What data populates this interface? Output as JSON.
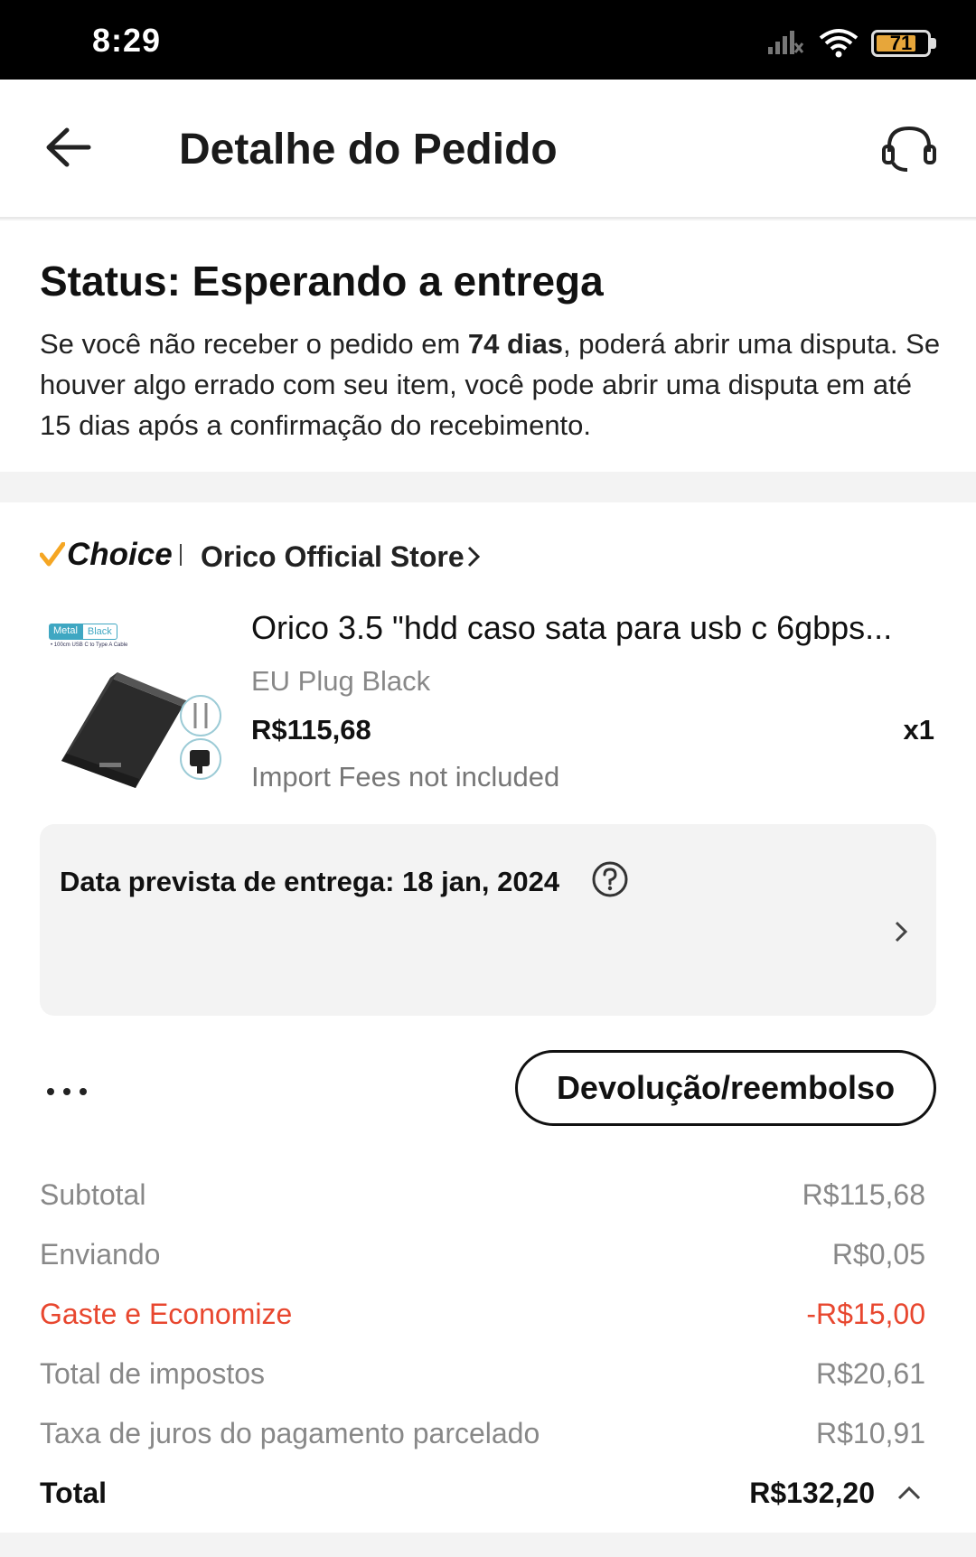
{
  "status_bar": {
    "time": "8:29",
    "battery_level": "71",
    "icons": [
      "signal-icon",
      "wifi-icon",
      "battery-icon"
    ]
  },
  "header": {
    "title": "Detalhe do Pedido",
    "back_icon": "arrow-left-icon",
    "support_icon": "headset-icon"
  },
  "status": {
    "title": "Status: Esperando a entrega",
    "desc_prefix": "Se você não receber o pedido em ",
    "desc_days": "74 dias",
    "desc_suffix": ", poderá abrir uma disputa. Se houver algo errado com seu item, você pode abrir uma disputa em até 15 dias após a confirmação do recebimento."
  },
  "store": {
    "choice_label": "Choice",
    "name": "Orico Official Store"
  },
  "product": {
    "name": "Orico 3.5 \"hdd caso sata para usb c 6gbps...",
    "variant": "EU Plug Black",
    "price": "R$115,68",
    "quantity": "x1",
    "fees_note": "Import Fees not included",
    "thumb_badge_1": "Metal",
    "thumb_badge_2": "Black",
    "thumb_caption": "• 100cm USB C to Type A Cable"
  },
  "delivery": {
    "label": "Data prevista de entrega: 18 jan, 2024"
  },
  "actions": {
    "refund_label": "Devolução/reembolso"
  },
  "summary": [
    {
      "label": "Subtotal",
      "value": "R$115,68"
    },
    {
      "label": "Enviando",
      "value": "R$0,05"
    },
    {
      "label": "Gaste e Economize",
      "value": "-R$15,00"
    },
    {
      "label": "Total de impostos",
      "value": "R$20,61"
    },
    {
      "label": "Taxa de juros do pagamento parcelado",
      "value": "R$10,91"
    }
  ],
  "total": {
    "label": "Total",
    "value": "R$132,20"
  },
  "colors": {
    "discount": "#e8472f",
    "choice_check": "#f5a623",
    "badge": "#3fa7c2"
  }
}
